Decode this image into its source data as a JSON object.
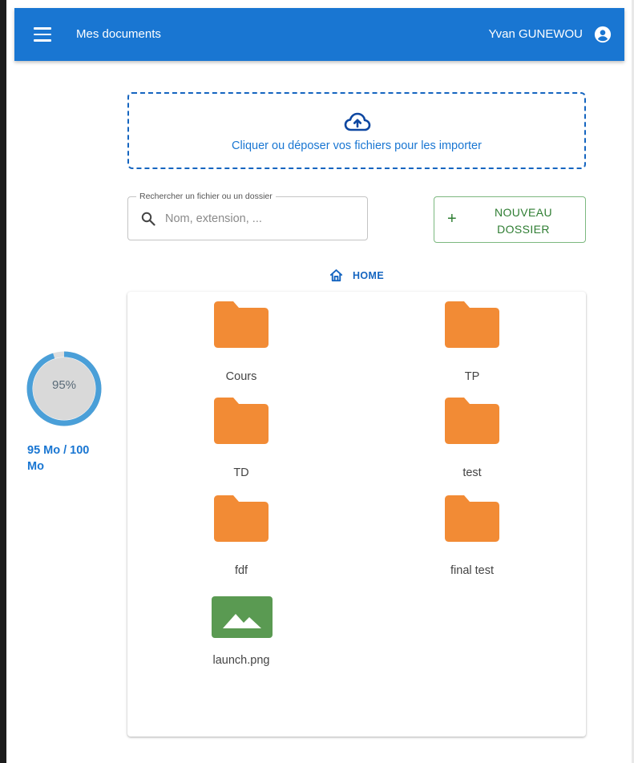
{
  "header": {
    "title": "Mes documents",
    "user_name": "Yvan GUNEWOU",
    "menu_icon": "hamburger-menu-icon",
    "user_icon": "account-circle-icon",
    "color": "#1976d2"
  },
  "upload": {
    "icon": "cloud-upload-icon",
    "text": "Cliquer ou déposer vos fichiers pour les importer"
  },
  "search": {
    "label": "Rechercher un fichier ou un dossier",
    "placeholder": "Nom, extension, ...",
    "value": ""
  },
  "new_folder": {
    "plus": "+",
    "label": "NOUVEAU\nDOSSIER",
    "color": "#2e7d32"
  },
  "breadcrumb": {
    "icon": "home-icon",
    "label": "HOME"
  },
  "items": [
    {
      "name": "Cours",
      "type": "folder"
    },
    {
      "name": "TP",
      "type": "folder"
    },
    {
      "name": "TD",
      "type": "folder"
    },
    {
      "name": "test",
      "type": "folder"
    },
    {
      "name": "fdf",
      "type": "folder"
    },
    {
      "name": "final test",
      "type": "folder"
    },
    {
      "name": "launch.png",
      "type": "image"
    }
  ],
  "folder_color": "#f28b35",
  "image_color": "#5a9a52",
  "storage": {
    "percent_label": "95%",
    "percent": 95,
    "usage_text": "95 Mo / 100 Mo",
    "ring_color": "#4a9fd8"
  }
}
